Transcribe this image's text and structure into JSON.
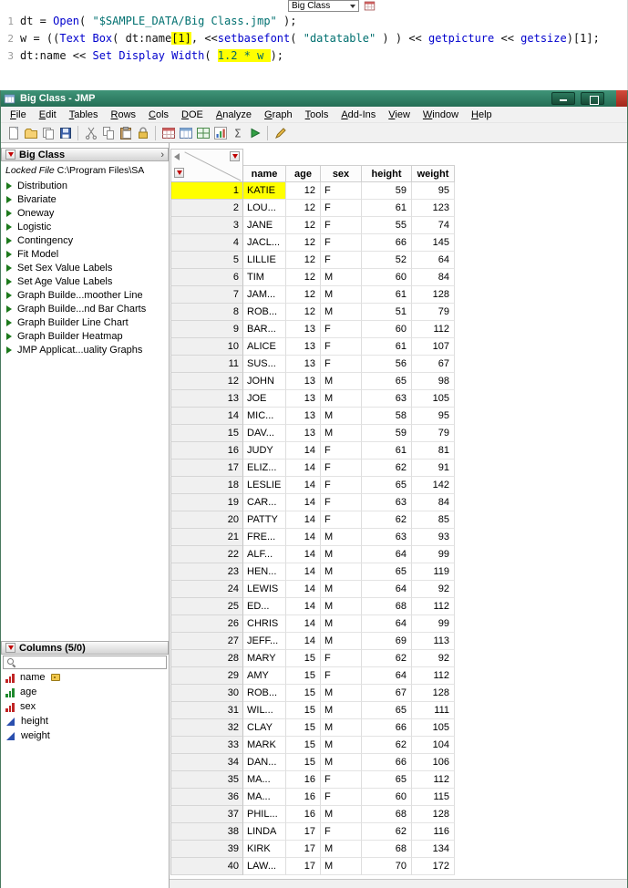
{
  "window": {
    "title": "Big Class - JMP"
  },
  "script_toolbar": {
    "dropdown_value": "Big Class"
  },
  "script_editor": {
    "lines": [
      {
        "num": "1",
        "segments": [
          {
            "t": "dt = ",
            "c": "p"
          },
          {
            "t": "Open",
            "c": "k"
          },
          {
            "t": "( ",
            "c": "p"
          },
          {
            "t": "\"$SAMPLE_DATA/Big Class.jmp\"",
            "c": "s"
          },
          {
            "t": " );",
            "c": "p"
          }
        ]
      },
      {
        "num": "2",
        "segments": [
          {
            "t": "w = ((",
            "c": "p"
          },
          {
            "t": "Text Box",
            "c": "k"
          },
          {
            "t": "( dt:name",
            "c": "p"
          },
          {
            "t": "[1]",
            "c": "p",
            "hl": true
          },
          {
            "t": ", <<",
            "c": "p"
          },
          {
            "t": "setbasefont",
            "c": "k"
          },
          {
            "t": "( ",
            "c": "p"
          },
          {
            "t": "\"datatable\"",
            "c": "s"
          },
          {
            "t": " ) ) << ",
            "c": "p"
          },
          {
            "t": "getpicture",
            "c": "k"
          },
          {
            "t": " << ",
            "c": "p"
          },
          {
            "t": "getsize",
            "c": "k"
          },
          {
            "t": ")[1];",
            "c": "p"
          }
        ]
      },
      {
        "num": "3",
        "segments": [
          {
            "t": "dt:name << ",
            "c": "p"
          },
          {
            "t": "Set Display Width",
            "c": "k"
          },
          {
            "t": "( ",
            "c": "p"
          },
          {
            "t": "1.2 * w ",
            "c": "n",
            "hl": true
          },
          {
            "t": ");",
            "c": "p"
          }
        ]
      }
    ]
  },
  "menu": {
    "items": [
      "File",
      "Edit",
      "Tables",
      "Rows",
      "Cols",
      "DOE",
      "Analyze",
      "Graph",
      "Tools",
      "Add-Ins",
      "View",
      "Window",
      "Help"
    ]
  },
  "toolbar": {
    "groups": [
      [
        "new-journal-icon",
        "open-icon",
        "save-as-icon",
        "save-icon"
      ],
      [
        "cut-icon",
        "copy-icon",
        "paste-icon",
        "lock-icon"
      ],
      [
        "data-table-icon",
        "journal-icon",
        "layout-icon",
        "graph-icon",
        "formula-icon",
        "run-script-icon"
      ],
      [
        "annotate-icon"
      ]
    ]
  },
  "sidebar": {
    "table_panel": {
      "title": "Big Class",
      "locked_label": "Locked File",
      "locked_path": " C:\\Program Files\\SA",
      "items": [
        "Distribution",
        "Bivariate",
        "Oneway",
        "Logistic",
        "Contingency",
        "Fit Model",
        "Set Sex Value Labels",
        "Set Age Value Labels",
        "Graph Builde...moother Line",
        "Graph Builde...nd Bar Charts",
        "Graph Builder Line Chart",
        "Graph Builder Heatmap",
        "JMP Applicat...uality Graphs"
      ]
    },
    "columns_panel": {
      "title": "Columns (5/0)",
      "search_value": "",
      "items": [
        {
          "label": "name",
          "type": "nominal",
          "tag": true
        },
        {
          "label": "age",
          "type": "ordinal"
        },
        {
          "label": "sex",
          "type": "nominal"
        },
        {
          "label": "height",
          "type": "continuous"
        },
        {
          "label": "weight",
          "type": "continuous"
        }
      ]
    }
  },
  "table": {
    "columns": [
      "name",
      "age",
      "sex",
      "height",
      "weight"
    ],
    "selected_row": 1,
    "rows": [
      [
        1,
        "KATIE",
        12,
        "F",
        59,
        95
      ],
      [
        2,
        "LOU...",
        12,
        "F",
        61,
        123
      ],
      [
        3,
        "JANE",
        12,
        "F",
        55,
        74
      ],
      [
        4,
        "JACL...",
        12,
        "F",
        66,
        145
      ],
      [
        5,
        "LILLIE",
        12,
        "F",
        52,
        64
      ],
      [
        6,
        "TIM",
        12,
        "M",
        60,
        84
      ],
      [
        7,
        "JAM...",
        12,
        "M",
        61,
        128
      ],
      [
        8,
        "ROB...",
        12,
        "M",
        51,
        79
      ],
      [
        9,
        "BAR...",
        13,
        "F",
        60,
        112
      ],
      [
        10,
        "ALICE",
        13,
        "F",
        61,
        107
      ],
      [
        11,
        "SUS...",
        13,
        "F",
        56,
        67
      ],
      [
        12,
        "JOHN",
        13,
        "M",
        65,
        98
      ],
      [
        13,
        "JOE",
        13,
        "M",
        63,
        105
      ],
      [
        14,
        "MIC...",
        13,
        "M",
        58,
        95
      ],
      [
        15,
        "DAV...",
        13,
        "M",
        59,
        79
      ],
      [
        16,
        "JUDY",
        14,
        "F",
        61,
        81
      ],
      [
        17,
        "ELIZ...",
        14,
        "F",
        62,
        91
      ],
      [
        18,
        "LESLIE",
        14,
        "F",
        65,
        142
      ],
      [
        19,
        "CAR...",
        14,
        "F",
        63,
        84
      ],
      [
        20,
        "PATTY",
        14,
        "F",
        62,
        85
      ],
      [
        21,
        "FRE...",
        14,
        "M",
        63,
        93
      ],
      [
        22,
        "ALF...",
        14,
        "M",
        64,
        99
      ],
      [
        23,
        "HEN...",
        14,
        "M",
        65,
        119
      ],
      [
        24,
        "LEWIS",
        14,
        "M",
        64,
        92
      ],
      [
        25,
        "ED...",
        14,
        "M",
        68,
        112
      ],
      [
        26,
        "CHRIS",
        14,
        "M",
        64,
        99
      ],
      [
        27,
        "JEFF...",
        14,
        "M",
        69,
        113
      ],
      [
        28,
        "MARY",
        15,
        "F",
        62,
        92
      ],
      [
        29,
        "AMY",
        15,
        "F",
        64,
        112
      ],
      [
        30,
        "ROB...",
        15,
        "M",
        67,
        128
      ],
      [
        31,
        "WIL...",
        15,
        "M",
        65,
        111
      ],
      [
        32,
        "CLAY",
        15,
        "M",
        66,
        105
      ],
      [
        33,
        "MARK",
        15,
        "M",
        62,
        104
      ],
      [
        34,
        "DAN...",
        15,
        "M",
        66,
        106
      ],
      [
        35,
        "MA...",
        16,
        "F",
        65,
        112
      ],
      [
        36,
        "MA...",
        16,
        "F",
        60,
        115
      ],
      [
        37,
        "PHIL...",
        16,
        "M",
        68,
        128
      ],
      [
        38,
        "LINDA",
        17,
        "F",
        62,
        116
      ],
      [
        39,
        "KIRK",
        17,
        "M",
        68,
        134
      ],
      [
        40,
        "LAW...",
        17,
        "M",
        70,
        172
      ]
    ]
  },
  "colors": {
    "selection_highlight": "#ffff00",
    "titlebar_light": "#3f9478",
    "titlebar_dark": "#256e55"
  }
}
